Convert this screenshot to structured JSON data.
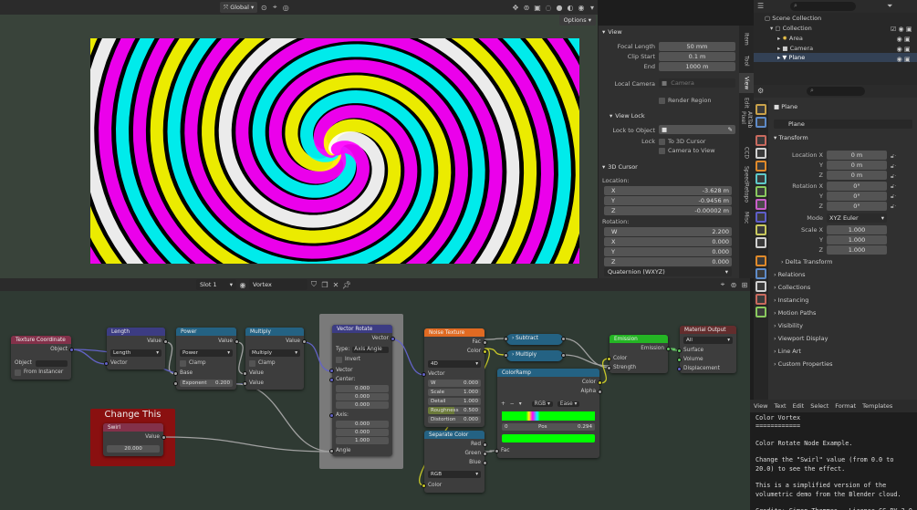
{
  "viewport": {
    "orientation": "Global",
    "options": "Options"
  },
  "npanel": {
    "view_section": "View",
    "focal_length_label": "Focal Length",
    "focal_length": "50 mm",
    "clip_start_label": "Clip Start",
    "clip_start": "0.1 m",
    "end_label": "End",
    "end": "1000 m",
    "local_camera_label": "Local Camera",
    "camera_placeholder": "Camera",
    "render_region": "Render Region",
    "view_lock_section": "View Lock",
    "lock_to_object_label": "Lock to Object",
    "lock_label": "Lock",
    "to_3d_cursor": "To 3D Cursor",
    "camera_to_view": "Camera to View",
    "cursor_section": "3D Cursor",
    "location_label": "Location:",
    "cx": "-3.628 m",
    "cy": "-0.9456 m",
    "cz": "-0.00002 m",
    "rotation_label": "Rotation:",
    "rw": "2.200",
    "rx": "0.000",
    "ry": "0.000",
    "rz": "0.000",
    "rot_mode": "Quaternion (WXYZ)",
    "x": "X",
    "y": "Y",
    "z": "Z",
    "w": "W"
  },
  "vtabs": [
    "Item",
    "Tool",
    "View",
    "Edit",
    "AltTab Pixel",
    "CCD",
    "SpeedRetopo",
    "Misc"
  ],
  "outliner": {
    "scene_collection": "Scene Collection",
    "collection": "Collection",
    "area": "Area",
    "camera": "Camera",
    "plane": "Plane"
  },
  "properties": {
    "object_name": "Plane",
    "object_field": "Plane",
    "transform": "Transform",
    "location_x_label": "Location X",
    "y_label": "Y",
    "z_label": "Z",
    "loc_x": "0 m",
    "loc_y": "0 m",
    "loc_z": "0 m",
    "rotation_x_label": "Rotation X",
    "rot_x": "0°",
    "rot_y": "0°",
    "rot_z": "0°",
    "mode_label": "Mode",
    "mode": "XYZ Euler",
    "scale_x_label": "Scale X",
    "sc_x": "1.000",
    "sc_y": "1.000",
    "sc_z": "1.000",
    "delta_transform": "Delta Transform",
    "relations": "Relations",
    "collections": "Collections",
    "instancing": "Instancing",
    "motion_paths": "Motion Paths",
    "visibility": "Visibility",
    "viewport_display": "Viewport Display",
    "line_art": "Line Art",
    "custom_properties": "Custom Properties"
  },
  "text_editor": {
    "menu": [
      "View",
      "Text",
      "Edit",
      "Select",
      "Format",
      "Templates"
    ],
    "lines": [
      "Color Vortex",
      "============",
      "",
      "Color Rotate Node Example.",
      "",
      "Change the \"Swirl\" value (from 0.0 to",
      "20.0) to see the effect.",
      "",
      "This is a simplified version of the",
      "volumetric demo from the Blender cloud.",
      "",
      "Credits: Simon Thommes - License CC-BY 3.0"
    ]
  },
  "node_header": {
    "slot": "Slot 1",
    "material": "Vortex"
  },
  "nodes": {
    "texcoord": {
      "title": "Texture Coordinate",
      "object_out": "Object",
      "object_label": "Object",
      "from_instancer": "From Instancer"
    },
    "length": {
      "title": "Length",
      "value": "Value",
      "mode": "Length",
      "vector": "Vector"
    },
    "power": {
      "title": "Power",
      "value": "Value",
      "mode": "Power",
      "clamp": "Clamp",
      "base": "Base",
      "exponent": "Exponent",
      "exponent_val": "0.200"
    },
    "multiply1": {
      "title": "Multiply",
      "value": "Value",
      "mode": "Multiply",
      "clamp": "Clamp",
      "in1": "Value",
      "in2": "Value"
    },
    "vrotate": {
      "title": "Vector Rotate",
      "vector_out": "Vector",
      "type_label": "Type:",
      "type": "Axis Angle",
      "invert": "Invert",
      "vector": "Vector",
      "center": "Center:",
      "c1": "0.000",
      "c2": "0.000",
      "c3": "0.000",
      "axis": "Axis:",
      "a1": "0.000",
      "a2": "0.000",
      "a3": "1.000",
      "angle": "Angle"
    },
    "noise": {
      "title": "Noise Texture",
      "fac": "Fac",
      "color": "Color",
      "dim": "4D",
      "vector": "Vector",
      "w": "W",
      "w_val": "0.000",
      "scale": "Scale",
      "scale_val": "1.000",
      "detail": "Detail",
      "detail_val": "1.000",
      "roughness": "Roughness",
      "rough_val": "0.500",
      "distortion": "Distortion",
      "dist_val": "0.000"
    },
    "subtract": {
      "title": "Subtract"
    },
    "multiply2": {
      "title": "Multiply"
    },
    "emission": {
      "title": "Emission",
      "emission_out": "Emission",
      "color": "Color",
      "strength": "Strength"
    },
    "output": {
      "title": "Material Output",
      "target": "All",
      "surface": "Surface",
      "volume": "Volume",
      "displacement": "Displacement"
    },
    "colorramp": {
      "title": "ColorRamp",
      "color": "Color",
      "alpha": "Alpha",
      "mode": "RGB",
      "interp": "Ease",
      "index": "0",
      "pos_label": "Pos",
      "pos": "0.294",
      "fac": "Fac"
    },
    "sepcolor": {
      "title": "Separate Color",
      "red": "Red",
      "green": "Green",
      "blue": "Blue",
      "mode": "RGB",
      "color": "Color"
    },
    "swirl_frame": {
      "title": "Change This"
    },
    "swirl": {
      "title": "Swirl",
      "value": "Value",
      "value_val": "20.000"
    }
  },
  "colors": {
    "accent": "#4772b3",
    "frame_red": "#8a1010",
    "input_node": "#83314a",
    "vector_node": "#3c3c83",
    "texture_node": "#e06a22",
    "converter_node": "#246283",
    "shader_node": "#24b524",
    "output_node": "#632d2d"
  }
}
